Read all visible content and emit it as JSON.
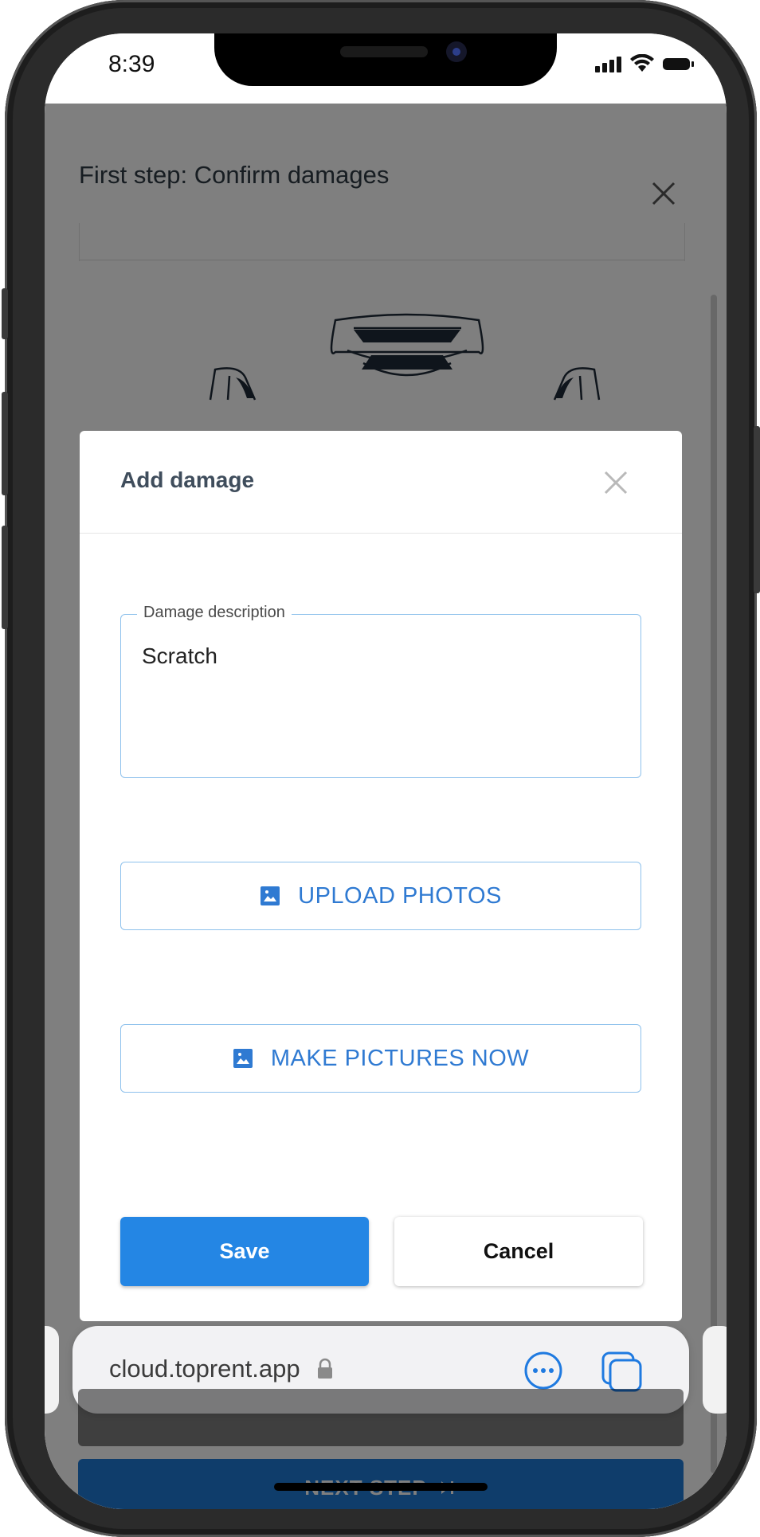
{
  "status_bar": {
    "time": "8:39",
    "icons": [
      "signal-icon",
      "wifi-icon",
      "battery-icon"
    ]
  },
  "page": {
    "title": "First step: Confirm damages",
    "close_icon": "close-icon",
    "next_step_label": "NEXT STEP",
    "next_step_icon": "skip-next-icon"
  },
  "modal": {
    "title": "Add damage",
    "close_icon": "close-icon",
    "description_field": {
      "label": "Damage description",
      "value": "Scratch"
    },
    "upload_photos_label": "UPLOAD PHOTOS",
    "make_pictures_label": "MAKE PICTURES NOW",
    "button_icon": "image-icon",
    "save_label": "Save",
    "cancel_label": "Cancel"
  },
  "browser": {
    "url": "cloud.toprent.app",
    "icons": [
      "lock-icon",
      "more-icon",
      "tabs-icon"
    ]
  },
  "colors": {
    "primary": "#2486e4",
    "outline": "#8ec1ec",
    "accent_text": "#2f7ad2",
    "overlay": "rgba(0,0,0,0.5)"
  }
}
